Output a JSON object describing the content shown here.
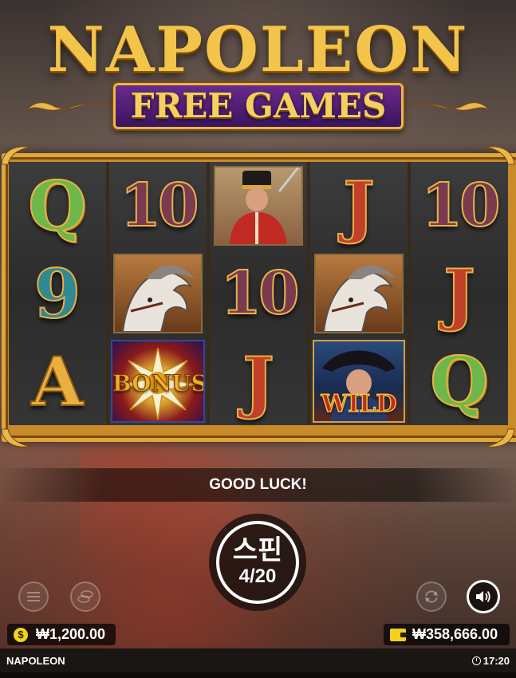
{
  "game": {
    "title": "NAPOLEON",
    "subtitle": "FREE GAMES"
  },
  "reels": [
    [
      "Q",
      "9",
      "A"
    ],
    [
      "10",
      "horse",
      "bonus"
    ],
    [
      "soldier",
      "10",
      "J"
    ],
    [
      "J",
      "horse",
      "wild"
    ],
    [
      "10",
      "J",
      "Q"
    ]
  ],
  "symbols": {
    "bonus_label": "BONUS",
    "wild_label": "WILD"
  },
  "message": "GOOD LUCK!",
  "spin": {
    "label": "스핀",
    "count": "4/20"
  },
  "bet": {
    "value": "₩1,200.00",
    "icon": "coin-icon"
  },
  "balance": {
    "value": "₩358,666.00",
    "icon": "wallet-icon"
  },
  "footer": {
    "game_name": "NAPOLEON",
    "time": "17:20"
  },
  "colors": {
    "gold": "#e0a63a",
    "purple": "#6a2a8a",
    "coin_yellow": "#f2d21a"
  }
}
